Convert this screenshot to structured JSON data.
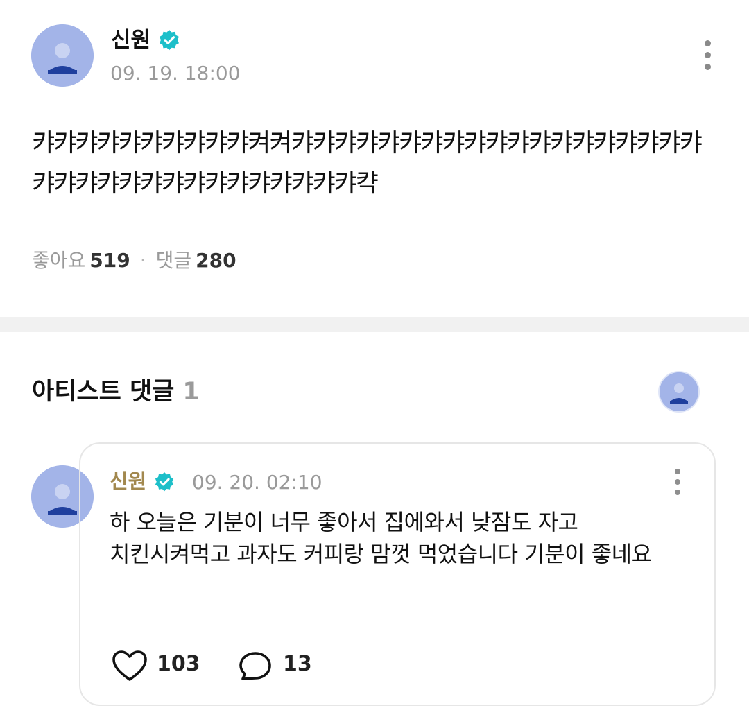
{
  "post": {
    "author": "신원",
    "timestamp": "09. 19. 18:00",
    "body": "캬캬캬캬캬캬캬캬캬캬켜켜캬캬캬캬캬캬캬캬캬캬캬캬캬캬캬캬캬캬캬캬캬캬캬캬캬캬캬캬캬캬캬캬캬캬캭",
    "likes_label": "좋아요",
    "likes_count": "519",
    "separator": "·",
    "comments_label": "댓글",
    "comments_count": "280"
  },
  "artist_comments": {
    "title": "아티스트 댓글",
    "count": "1"
  },
  "comment": {
    "author": "신원",
    "timestamp": "09. 20. 02:10",
    "body": "하 오늘은 기분이 너무 좋아서 집에와서 낮잠도 자고 치킨시켜먹고 과자도 커피랑 맘껏 먹었습니다 기분이 좋네요",
    "likes_count": "103",
    "replies_count": "13"
  },
  "icons": {
    "verified": "verified-badge-icon",
    "more": "more-vertical-icon",
    "like": "heart-outline-icon",
    "reply": "speech-bubble-icon"
  },
  "colors": {
    "verified": "#1dbfc9",
    "comment_author": "#a2884e",
    "muted_text": "#9a9a9a",
    "avatar_bg": "#9fb1e6"
  }
}
